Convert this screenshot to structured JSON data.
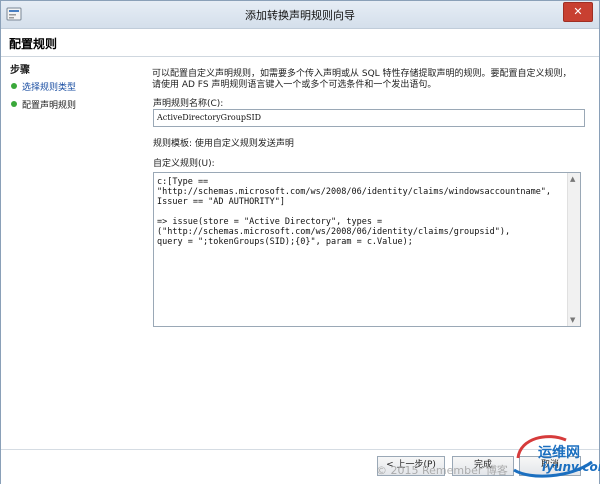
{
  "window": {
    "title": "添加转换声明规则向导",
    "close_glyph": "✕"
  },
  "page": {
    "title": "配置规则"
  },
  "steps": {
    "heading": "步骤",
    "items": [
      {
        "label": "选择规则类型"
      },
      {
        "label": "配置声明规则"
      }
    ]
  },
  "content": {
    "description": "可以配置自定义声明规则，如需要多个传入声明或从 SQL 特性存储提取声明的规则。要配置自定义规则，请使用 AD FS 声明规则语言键入一个或多个可选条件和一个发出语句。",
    "rule_name_label": "声明规则名称(C):",
    "rule_name_value": "ActiveDirectoryGroupSID",
    "template_label": "规则模板: 使用自定义规则发送声明",
    "custom_rule_label": "自定义规则(U):",
    "custom_rule_text": "c:[Type ==\n\"http://schemas.microsoft.com/ws/2008/06/identity/claims/windowsaccountname\", Issuer == \"AD AUTHORITY\"]\n\n=> issue(store = \"Active Directory\", types =\n(\"http://schemas.microsoft.com/ws/2008/06/identity/claims/groupsid\"),\nquery = \";tokenGroups(SID);{0}\", param = c.Value);"
  },
  "footer": {
    "prev_label": "< 上一步(P)",
    "finish_label": "完成",
    "cancel_label": "取消"
  },
  "overlay": {
    "watermark": "© 2015 Remember 博客",
    "logo_cn": "运维网",
    "logo_en": "iyunv.com"
  },
  "colors": {
    "step_dot": "#3aa83a",
    "step_link": "#1a4ea2",
    "close_button": "#c84031",
    "logo": "#1b6fc0"
  }
}
